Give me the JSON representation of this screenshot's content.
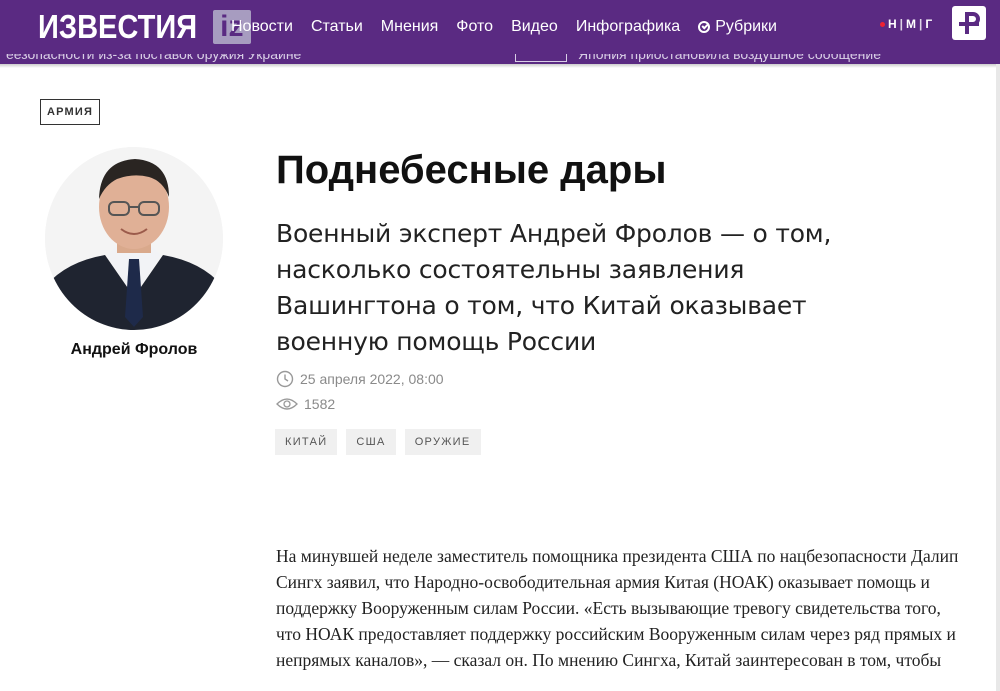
{
  "header": {
    "logo_word": "ИЗВЕСТИЯ",
    "logo_badge": "iz",
    "nav": [
      "Новости",
      "Статьи",
      "Мнения",
      "Фото",
      "Видео",
      "Инфографика"
    ],
    "rubrics_label": "Рубрики",
    "partner": {
      "n": "Н",
      "m": "М",
      "g": "Г"
    },
    "ticker": {
      "left": "еезопасности из-за поставок оружия Украине",
      "right": "Япония приостановила воздушное сообщение"
    },
    "brand_color": "#5a2a82"
  },
  "article": {
    "rubric": "АРМИЯ",
    "author": "Андрей Фролов",
    "title": "Поднебесные дары",
    "subtitle": "Военный эксперт Андрей Фролов — о том, насколько состоятельны заявления Вашингтона о том, что Китай оказывает военную помощь России",
    "date": "25 апреля 2022, 08:00",
    "views": "1582",
    "tags": [
      "КИТАЙ",
      "США",
      "ОРУЖИЕ"
    ],
    "body": "На минувшей неделе заместитель помощника президента США по нацбезопасности Далип Сингх заявил, что Народно-освободительная армия Китая (НОАК) оказывает помощь и поддержку Вооруженным силам России. «Есть вызывающие тревогу свидетельства того, что НОАК предоставляет поддержку российским Вооруженным силам через ряд прямых и непрямых каналов», — сказал он. По мнению Сингха, Китай заинтересован в том, чтобы"
  }
}
